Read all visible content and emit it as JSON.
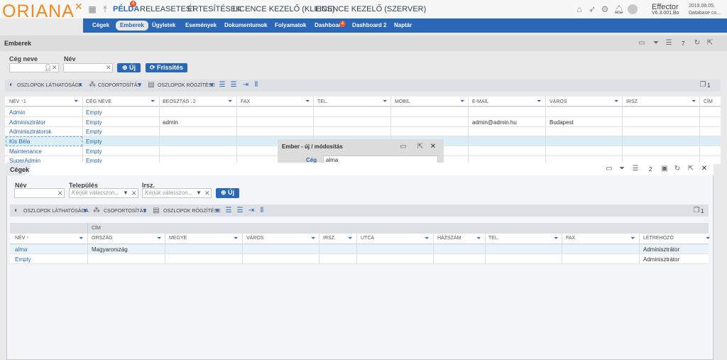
{
  "app": {
    "logo": "ORIANA",
    "user": "Effector",
    "version": "V6.3.001.Bo",
    "date": "2019.08.05.",
    "db": "Database co...",
    "top_menu": [
      {
        "label": "PÉLDA",
        "badge": "4"
      },
      {
        "label": "RELEASETEST"
      },
      {
        "label": "ÉRTESÍTÉSEK"
      },
      {
        "label": "LICENCE KEZELŐ (KLIENS)"
      },
      {
        "label": "LICENCE KEZELŐ (SZERVER)"
      }
    ],
    "nav": [
      "Cégek",
      "Emberek",
      "Ügyletek",
      "Események",
      "Dokumentumok",
      "Folyamatok",
      "Dashboard",
      "Dashboard 2",
      "Naptár"
    ],
    "nav_badge": "4",
    "accent": "#2b67b7",
    "brand": "#f28a21"
  },
  "emberek": {
    "title": "Emberek",
    "count": "7",
    "filter_company_label": "Cég neve",
    "filter_name_label": "Név",
    "new_label": "Új",
    "refresh_label": "Frissítés",
    "toolbar": {
      "visibility": "OSZLOPOK LÁTHATÓSÁGA",
      "grouping": "CSOPORTOSÍTÁS",
      "fix": "OSZLOPOK RÖGZÍTÉSE",
      "count": "1"
    },
    "columns": [
      "NÉV",
      "CÉG NEVE",
      "BEOSZTÁS",
      "FAX",
      "TEL.",
      "MOBIL",
      "E-MAIL",
      "VÁROS",
      "IRSZ.",
      "CÍM"
    ],
    "rows": [
      {
        "name": "Admin",
        "company": "Empty",
        "position": "",
        "email": "",
        "city": ""
      },
      {
        "name": "Adminisztrátor",
        "company": "Empty",
        "position": "admin",
        "email": "admin@admin.hu",
        "city": "Budapest"
      },
      {
        "name": "Adminisztrátorok",
        "company": "Empty",
        "position": "",
        "email": "",
        "city": ""
      },
      {
        "name": "Kis Béla",
        "company": "Empty",
        "position": "",
        "email": "",
        "city": ""
      },
      {
        "name": "Maintenance",
        "company": "Empty",
        "position": "",
        "email": "",
        "city": ""
      },
      {
        "name": "SuperAdmin",
        "company": "Empty",
        "position": "",
        "email": "",
        "city": ""
      }
    ]
  },
  "dialog": {
    "title": "Ember - új / módosítás",
    "company_label": "Cég",
    "company_value": "alma"
  },
  "cegek": {
    "title": "Cégek",
    "count": "2",
    "filter_name_label": "Név",
    "filter_town_label": "Település",
    "filter_zip_label": "Irsz.",
    "placeholder": "Kérjük válasszon...",
    "new_label": "Új",
    "toolbar": {
      "visibility": "OSZLOPOK LÁTHATÓSÁGA",
      "grouping": "CSOPORTOSÍTÁS",
      "fix": "OSZLOPOK RÖGZÍTÉSE",
      "count": "1"
    },
    "group_header": "CÍM",
    "columns": [
      "NÉV",
      "ORSZÁG",
      "MEGYE",
      "VÁROS",
      "IRSZ.",
      "UTCA",
      "HÁZSZÁM",
      "TEL.",
      "FAX",
      "LÉTREHOZÓ"
    ],
    "rows": [
      {
        "name": "alma",
        "country": "Magyarország",
        "creator": "Adminisztrátor"
      },
      {
        "name": "Empty",
        "country": "",
        "creator": "Adminisztrátor"
      }
    ]
  }
}
